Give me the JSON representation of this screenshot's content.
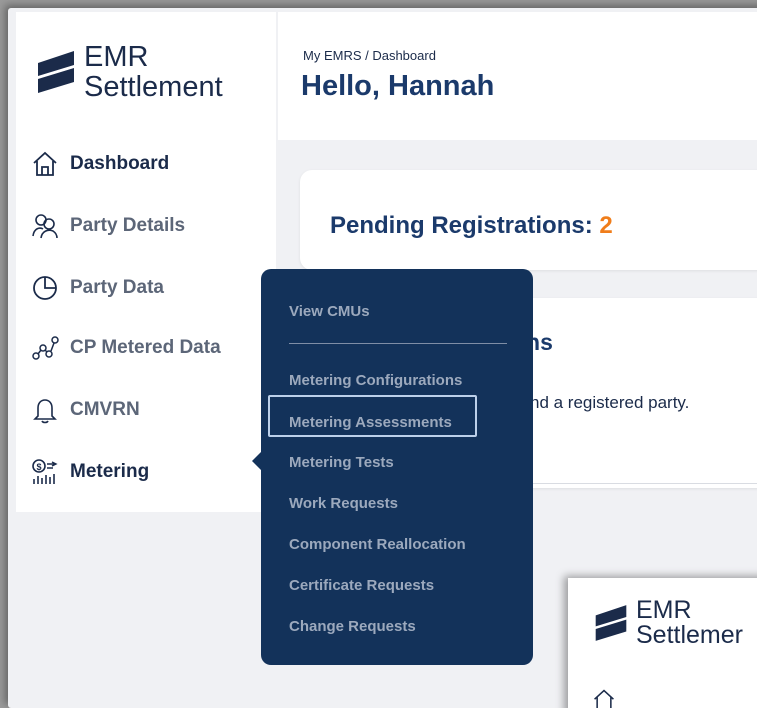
{
  "app": {
    "logo_line1": "EMR",
    "logo_line2": "Settlement"
  },
  "sidebar": {
    "items": [
      {
        "label": "Dashboard",
        "icon": "home-icon"
      },
      {
        "label": "Party Details",
        "icon": "people-icon"
      },
      {
        "label": "Party Data",
        "icon": "pie-chart-icon"
      },
      {
        "label": "CP Metered Data",
        "icon": "data-nodes-icon"
      },
      {
        "label": "CMVRN",
        "icon": "bell-icon"
      },
      {
        "label": "Metering",
        "icon": "metering-icon"
      }
    ]
  },
  "header": {
    "breadcrumb": "My EMRS / Dashboard",
    "title": "Hello, Hannah"
  },
  "pending": {
    "label": "Pending Registrations:",
    "count": "2"
  },
  "registrations": {
    "title_fragment": "ons",
    "desc_fragment": "nd a registered party."
  },
  "dropdown": {
    "items": [
      "View CMUs",
      "Metering Configurations",
      "Metering Assessments",
      "Metering Tests",
      "Work Requests",
      "Component Reallocation",
      "Certificate Requests",
      "Change Requests"
    ]
  },
  "window2": {
    "logo_line1": "EMR",
    "logo_line2": "Settlemer"
  },
  "colors": {
    "navy": "#13325a",
    "accent_orange": "#f07d1a",
    "title_blue": "#1b3a6b"
  }
}
